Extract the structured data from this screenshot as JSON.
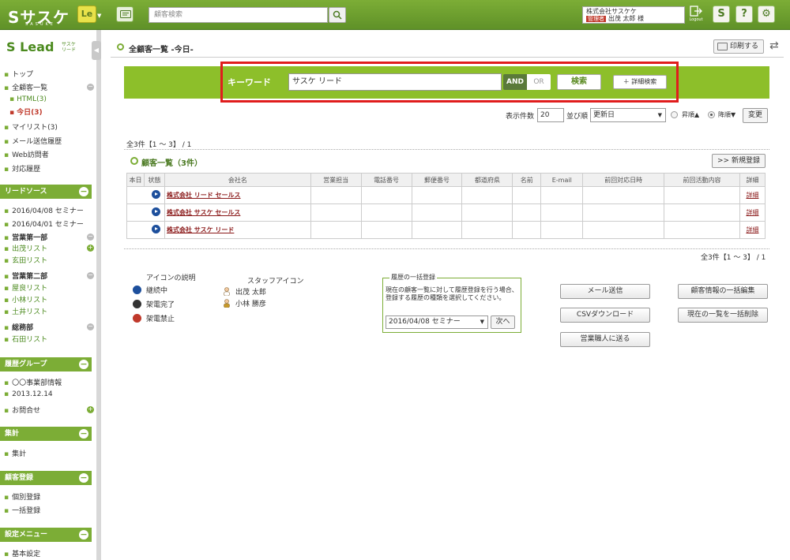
{
  "header": {
    "app_name": "サスケ",
    "app_sub": "SASUKE",
    "le_label": "Le",
    "search_placeholder": "顧客検索",
    "user_company": "株式会社サスケケ",
    "user_role": "管理者",
    "user_name": "出茂 太郎 様",
    "logout_label": "Logout",
    "help_label": "?"
  },
  "sidebar": {
    "logo": "Lead",
    "logo_sub1": "サスケ",
    "logo_sub2": "リード",
    "top_items": [
      {
        "label": "トップ"
      },
      {
        "label": "全顧客一覧"
      },
      {
        "label": "HTML(3)"
      },
      {
        "label": "今日(3)"
      },
      {
        "label": "マイリスト(3)"
      },
      {
        "label": "メール送信履歴"
      },
      {
        "label": "Web訪問者"
      },
      {
        "label": "対応履歴"
      }
    ],
    "lead_source": {
      "title": "リードソース",
      "items": [
        "2016/04/08 セミナー",
        "2016/04/01 セミナー"
      ],
      "groups": [
        {
          "name": "営業第一部",
          "items": [
            "出茂リスト",
            "玄田リスト"
          ]
        },
        {
          "name": "営業第二部",
          "items": [
            "屋良リスト",
            "小林リスト",
            "土井リスト"
          ]
        },
        {
          "name": "総務部",
          "items": [
            "石田リスト"
          ]
        }
      ]
    },
    "history_group": {
      "title": "履歴グループ",
      "items": [
        "〇〇事業部情報",
        "2013.12.14",
        "お問合せ"
      ]
    },
    "stats": {
      "title": "集計",
      "items": [
        "集計"
      ]
    },
    "registration": {
      "title": "顧客登録",
      "items": [
        "個別登録",
        "一括登録"
      ]
    },
    "settings": {
      "title": "設定メニュー",
      "items": [
        "基本設定"
      ]
    }
  },
  "main": {
    "page_title": "全顧客一覧 -今日-",
    "print_label": "印刷する",
    "search": {
      "keyword_label": "キーワード",
      "keyword_value": "サスケ リード",
      "and_label": "AND",
      "or_label": "OR",
      "search_label": "検索",
      "detail_label": "＋ 詳細検索"
    },
    "controls": {
      "display_count_label": "表示件数",
      "display_count": "20",
      "sort_label": "並び順",
      "sort_value": "更新日",
      "asc_label": "昇順▲",
      "desc_label": "降順▼",
      "change_label": "変更"
    },
    "count_top": "全3件【1 ～ 3】 / 1",
    "list_title": "顧客一覧（3件）",
    "new_label": ">> 新規登録",
    "table": {
      "headers": [
        "本日",
        "状態",
        "会社名",
        "営業担当",
        "電話番号",
        "郵便番号",
        "都道府県",
        "名前",
        "E-mail",
        "前回対応日時",
        "前回活動内容",
        "詳細"
      ],
      "rows": [
        {
          "company": "株式会社 リード セールス",
          "detail": "詳細"
        },
        {
          "company": "株式会社 サスケ セールス",
          "detail": "詳細"
        },
        {
          "company": "株式会社 サスケ リード",
          "detail": "詳細"
        }
      ]
    },
    "count_bottom": "全3件【1 ～ 3】 / 1",
    "legend": {
      "title": "アイコンの説明",
      "items": [
        "継続中",
        "架電完了",
        "架電禁止"
      ],
      "staff_title": "スタッフアイコン",
      "staff": [
        "出茂 太郎",
        "小林 勝彦"
      ]
    },
    "bulk": {
      "title": "履歴の一括登録",
      "description": "現在の顧客一覧に対して履歴登録を行う場合、登録する履歴の種類を選択してください。",
      "select_value": "2016/04/08 セミナー",
      "next_label": "次へ"
    },
    "actions": {
      "mail": "メール送信",
      "csv": "CSVダウンロード",
      "sales": "営業職人に送る",
      "bulk_edit": "顧客情報の一括編集",
      "bulk_delete": "現在の一覧を一括削除"
    }
  },
  "colors": {
    "accent": "#7cad36",
    "highlight": "#e01d1d",
    "link": "#8b1a1a"
  }
}
